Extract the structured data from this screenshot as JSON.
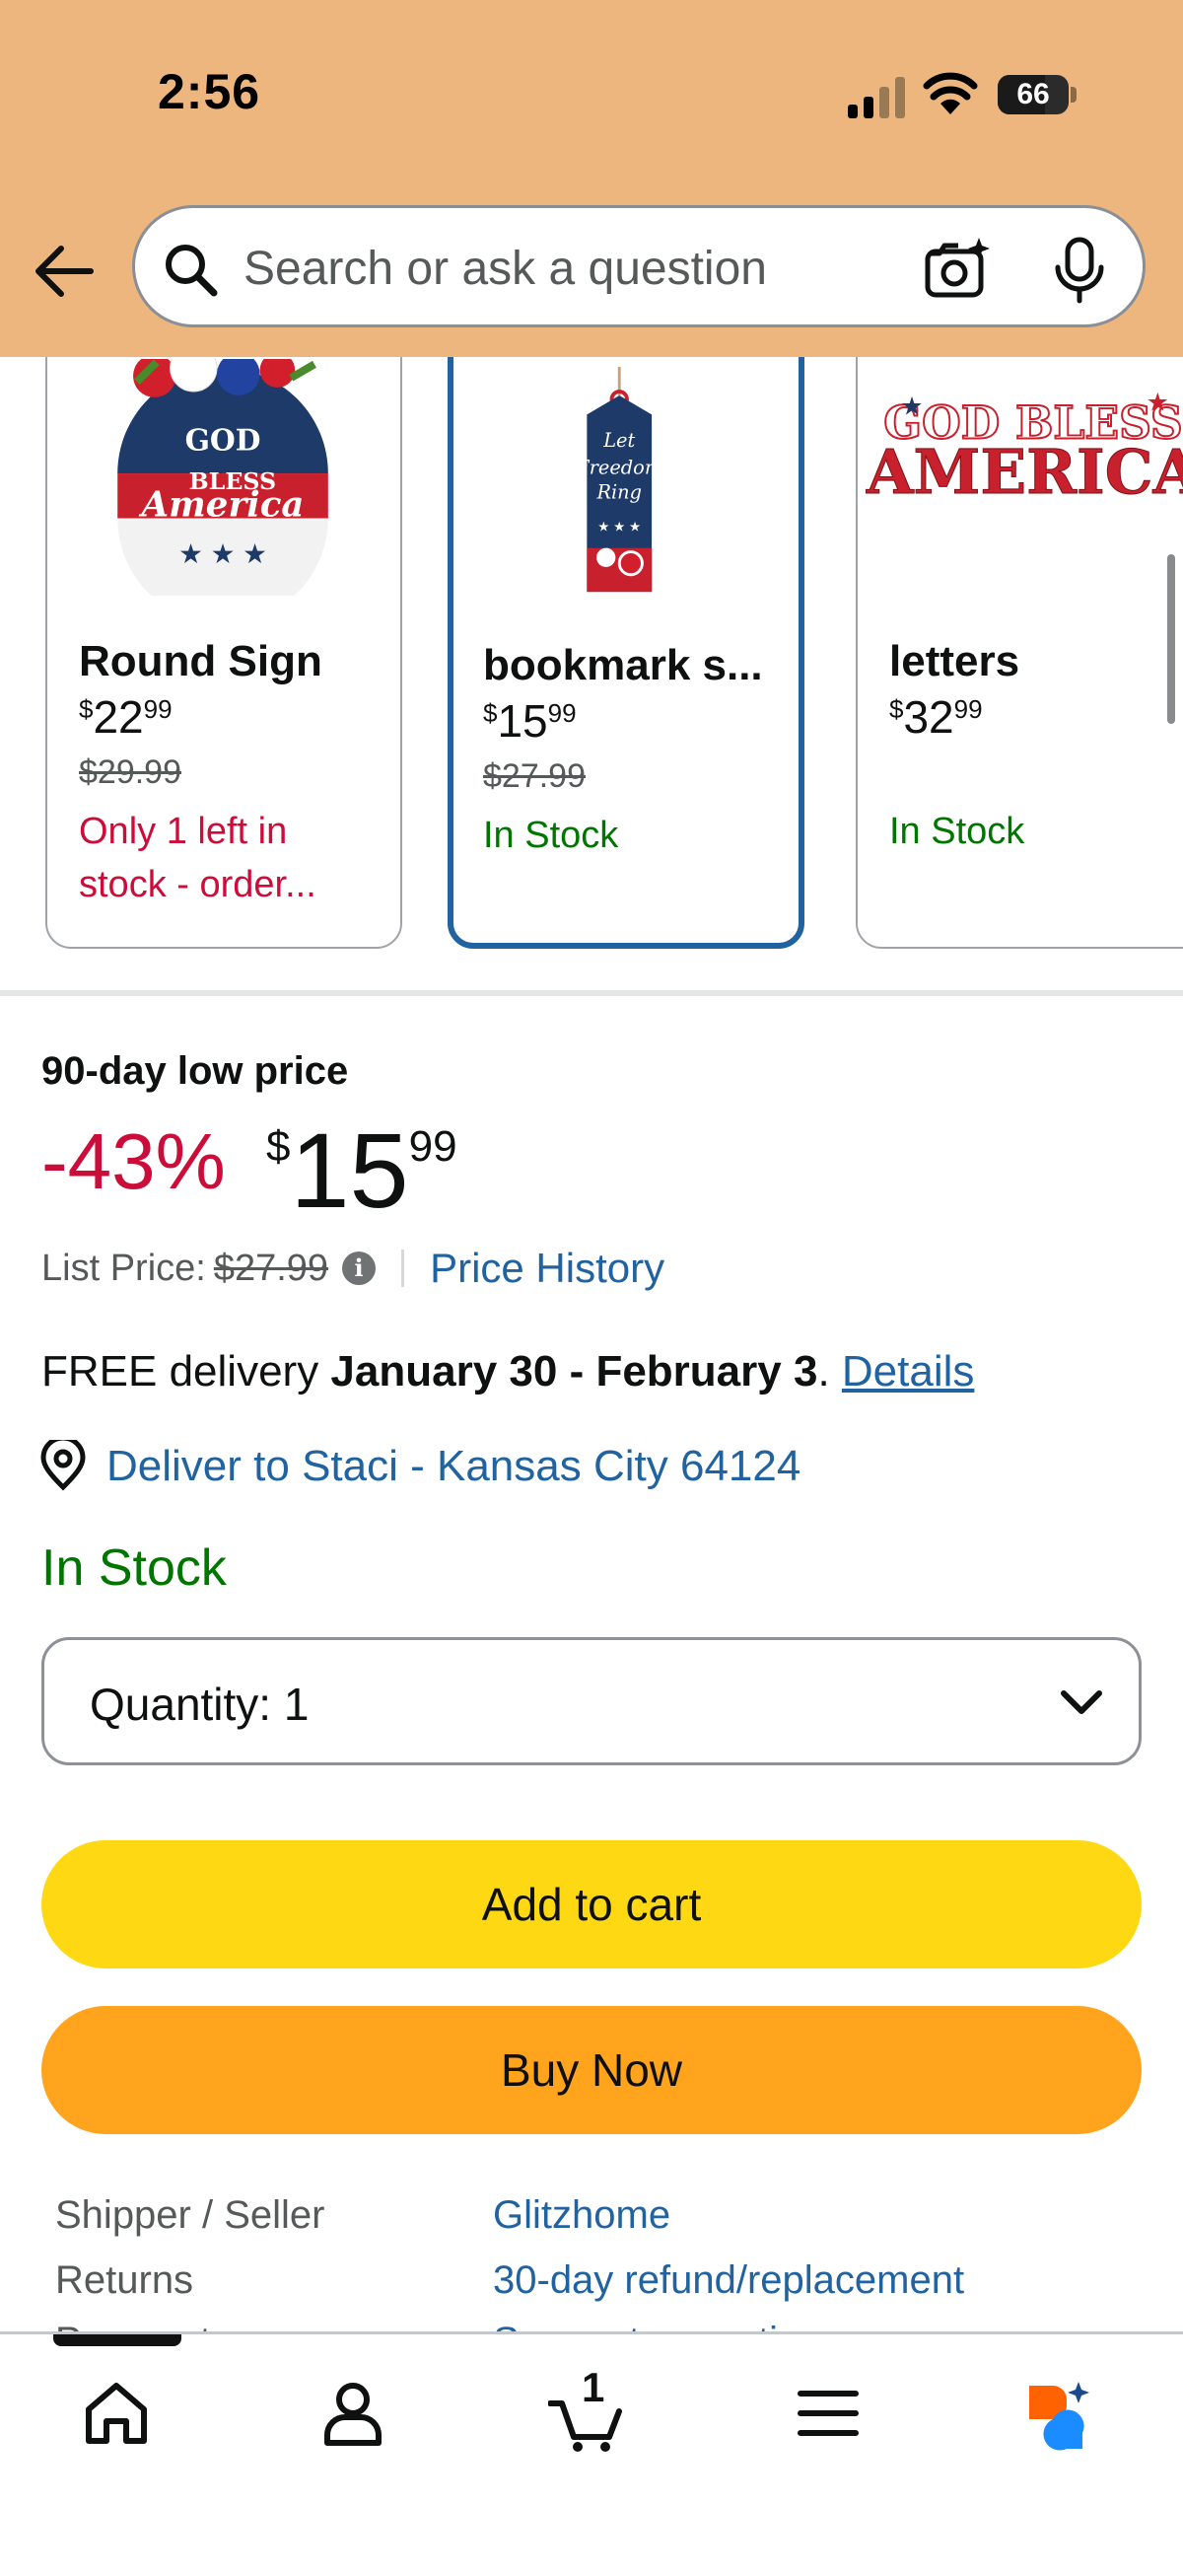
{
  "status_bar": {
    "time": "2:56",
    "battery": "66",
    "battery_level": 0.66
  },
  "search": {
    "placeholder": "Search or ask a question"
  },
  "carousel": {
    "items": [
      {
        "title": "Round Sign",
        "price_dollars": "22",
        "price_cents": "99",
        "old_price": "$29.99",
        "stock": "Only 1 left in stock - order...",
        "stock_type": "low"
      },
      {
        "title": "bookmark s...",
        "price_dollars": "15",
        "price_cents": "99",
        "old_price": "$27.99",
        "stock": "In Stock",
        "stock_type": "in"
      },
      {
        "title": "letters",
        "price_dollars": "32",
        "price_cents": "99",
        "old_price": "",
        "stock": "In Stock",
        "stock_type": "in"
      }
    ],
    "images": {
      "item1_top": "GOD",
      "item1_mid": "BLESS",
      "item1_bottom": "America",
      "item2_l1": "Let",
      "item2_l2": "Freedom",
      "item2_l3": "Ring",
      "item3_l1": "GOD BLESS",
      "item3_l2": "AMERICA"
    }
  },
  "price": {
    "deal_label": "90-day low price",
    "discount": "-43%",
    "currency": "$",
    "dollars": "15",
    "cents": "99",
    "list_price_label": "List Price:",
    "list_price": "$27.99",
    "price_history": "Price History"
  },
  "delivery": {
    "prefix": "FREE delivery ",
    "dates": "January 30 - February 3",
    "period": ". ",
    "details": "Details",
    "deliver_to": "Deliver to Staci - Kansas City 64124"
  },
  "availability": "In Stock",
  "quantity": {
    "label": "Quantity:",
    "value": "1"
  },
  "buttons": {
    "add_to_cart": "Add to cart",
    "buy_now": "Buy Now"
  },
  "info": [
    {
      "label": "Shipper / Seller",
      "value": "Glitzhome"
    },
    {
      "label": "Returns",
      "value": "30-day refund/replacement"
    }
  ],
  "partial_row": {
    "label": "Payment",
    "value": "Secure transaction"
  },
  "bottom_nav": {
    "cart_count": "1"
  },
  "colors": {
    "header_bg": "#edb67f",
    "link": "#2162a1",
    "discount": "#cc0c39",
    "in_stock": "#007600",
    "add_to_cart": "#ffd814",
    "buy_now": "#ffa41c"
  }
}
